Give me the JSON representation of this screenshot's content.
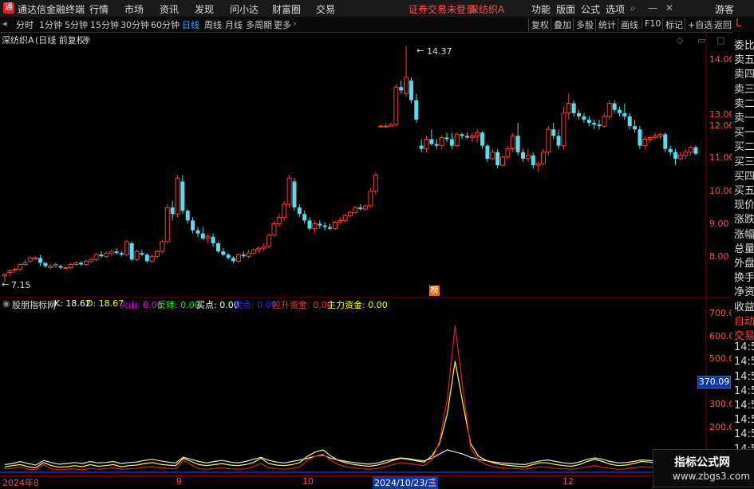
{
  "app": {
    "title": "通达信金融终端",
    "menu": [
      "行情",
      "市场",
      "资讯",
      "发现",
      "问小达",
      "财富圈",
      "交易"
    ],
    "warning": "证券交易未登录",
    "stock_title": "深纺织A",
    "right_menu": [
      "功能",
      "版面",
      "公式",
      "选项"
    ],
    "guest": "游客"
  },
  "toolbar": {
    "periods": [
      "分时",
      "1分钟",
      "5分钟",
      "15分钟",
      "30分钟",
      "60分钟",
      "日线",
      "周线",
      "月线",
      "多周期",
      "更多"
    ],
    "active_period": "日线",
    "right_buttons": [
      "复权",
      "叠加",
      "多股",
      "统计",
      "画线",
      "F10",
      "标记",
      "+自选",
      "返回"
    ]
  },
  "chart_header": {
    "name": "深纺织A",
    "mode": "(日线 前复权)"
  },
  "price_axis": [
    "14.00",
    "13.00",
    "12.00",
    "11.00",
    "10.00",
    "9.00",
    "8.00"
  ],
  "price_markers": {
    "high": "14.37",
    "low": "7.15"
  },
  "marker_label": "榜",
  "indicator": {
    "name": "股朋指标网",
    "items": [
      {
        "label": "K:",
        "value": "18.62",
        "color": "#ffffff"
      },
      {
        "label": "D:",
        "value": "18.67",
        "color": "#ffff00"
      },
      {
        "label": "火山:",
        "value": "0.00",
        "color": "#ff00ff"
      },
      {
        "label": "反转:",
        "value": "0.00",
        "color": "#00ff00"
      },
      {
        "label": "买点:",
        "value": "0.00",
        "color": "#ffffff"
      },
      {
        "label": "卖点:",
        "value": "0.00",
        "color": "#0000ff"
      },
      {
        "label": "拉升资金:",
        "value": "0.00",
        "color": "#ff3030"
      },
      {
        "label": "主力资金:",
        "value": "0.00",
        "color": "#ffff00"
      }
    ],
    "axis": [
      "700.0",
      "600.0",
      "500.0",
      "400.0",
      "300.0",
      "200.0"
    ],
    "current": "370.09"
  },
  "date_axis": {
    "labels": [
      "2024年8",
      "9",
      "10",
      "2024/10/23/三",
      "1",
      "12"
    ],
    "highlight": "2024/10/23/三"
  },
  "right_panel": [
    "委比",
    "卖五",
    "卖四",
    "卖三",
    "卖二",
    "卖一",
    "买一",
    "买二",
    "买三",
    "买四",
    "买五",
    "现价",
    "涨跌",
    "涨幅",
    "总量",
    "外盘",
    "换手",
    "净资",
    "收益",
    "自动",
    "交易",
    "14:56",
    "14:56",
    "14:56",
    "14:56",
    "14:56",
    "14:56",
    "14:56",
    "14:56",
    "14:56"
  ],
  "watermark": {
    "title": "指标公式网",
    "url": "www.zbgs3.com"
  },
  "chart_data": {
    "type": "candlestick",
    "ylim": [
      7.0,
      14.6
    ],
    "bars": [
      [
        7.3,
        7.4,
        7.1,
        7.35
      ],
      [
        7.4,
        7.5,
        7.3,
        7.45
      ],
      [
        7.5,
        7.55,
        7.4,
        7.5
      ],
      [
        7.5,
        7.7,
        7.45,
        7.65
      ],
      [
        7.65,
        7.8,
        7.6,
        7.7
      ],
      [
        7.75,
        7.9,
        7.7,
        7.85
      ],
      [
        7.85,
        7.9,
        7.8,
        7.85
      ],
      [
        7.85,
        7.95,
        7.6,
        7.7
      ],
      [
        7.7,
        7.7,
        7.55,
        7.6
      ],
      [
        7.55,
        7.65,
        7.5,
        7.6
      ],
      [
        7.6,
        7.7,
        7.55,
        7.65
      ],
      [
        7.6,
        7.65,
        7.5,
        7.55
      ],
      [
        7.55,
        7.6,
        7.5,
        7.55
      ],
      [
        7.55,
        7.7,
        7.5,
        7.65
      ],
      [
        7.65,
        7.75,
        7.6,
        7.7
      ],
      [
        7.7,
        7.75,
        7.6,
        7.65
      ],
      [
        7.65,
        7.8,
        7.6,
        7.75
      ],
      [
        7.75,
        7.85,
        7.7,
        7.8
      ],
      [
        7.8,
        8.0,
        7.75,
        7.95
      ],
      [
        7.95,
        8.05,
        7.85,
        7.9
      ],
      [
        7.9,
        8.05,
        7.85,
        8.0
      ],
      [
        8.0,
        8.1,
        7.9,
        8.05
      ],
      [
        8.05,
        8.15,
        7.95,
        8.0
      ],
      [
        8.0,
        8.05,
        7.9,
        7.95
      ],
      [
        7.95,
        8.4,
        7.9,
        8.35
      ],
      [
        8.3,
        8.35,
        7.75,
        7.8
      ],
      [
        7.8,
        8.1,
        7.75,
        8.05
      ],
      [
        8.0,
        8.1,
        7.9,
        7.95
      ],
      [
        7.95,
        8.0,
        7.7,
        7.75
      ],
      [
        7.75,
        7.95,
        7.7,
        7.9
      ],
      [
        7.9,
        8.1,
        7.85,
        8.05
      ],
      [
        8.05,
        8.4,
        8.0,
        8.35
      ],
      [
        8.35,
        9.5,
        8.3,
        9.4
      ],
      [
        9.4,
        9.6,
        9.0,
        9.2
      ],
      [
        9.2,
        10.4,
        9.1,
        10.3
      ],
      [
        10.2,
        10.4,
        9.2,
        9.3
      ],
      [
        9.3,
        9.35,
        8.9,
        9.0
      ],
      [
        9.0,
        9.1,
        8.6,
        8.7
      ],
      [
        8.7,
        8.8,
        8.5,
        8.6
      ],
      [
        8.6,
        8.8,
        8.4,
        8.45
      ],
      [
        8.45,
        8.6,
        8.3,
        8.5
      ],
      [
        8.5,
        8.6,
        8.2,
        8.3
      ],
      [
        8.3,
        8.35,
        8.0,
        8.05
      ],
      [
        8.05,
        8.15,
        7.9,
        7.95
      ],
      [
        7.95,
        8.0,
        7.8,
        7.85
      ],
      [
        7.85,
        7.9,
        7.7,
        7.75
      ],
      [
        7.75,
        8.0,
        7.7,
        7.95
      ],
      [
        7.95,
        8.05,
        7.85,
        7.9
      ],
      [
        7.9,
        8.1,
        7.85,
        8.0
      ],
      [
        8.0,
        8.15,
        7.95,
        8.1
      ],
      [
        8.1,
        8.2,
        8.0,
        8.15
      ],
      [
        8.15,
        8.3,
        8.05,
        8.2
      ],
      [
        8.2,
        8.6,
        8.15,
        8.55
      ],
      [
        8.55,
        9.0,
        8.5,
        8.9
      ],
      [
        8.9,
        9.2,
        8.8,
        9.1
      ],
      [
        9.1,
        9.6,
        9.0,
        9.5
      ],
      [
        9.5,
        10.4,
        9.4,
        10.3
      ],
      [
        10.2,
        10.3,
        9.3,
        9.4
      ],
      [
        9.4,
        9.5,
        9.1,
        9.2
      ],
      [
        9.2,
        9.3,
        8.9,
        9.0
      ],
      [
        9.0,
        9.1,
        8.7,
        8.75
      ],
      [
        8.75,
        9.0,
        8.6,
        8.9
      ],
      [
        8.9,
        9.0,
        8.75,
        8.85
      ],
      [
        8.85,
        8.95,
        8.7,
        8.8
      ],
      [
        8.8,
        8.9,
        8.7,
        8.75
      ],
      [
        8.75,
        9.0,
        8.7,
        8.95
      ],
      [
        8.95,
        9.1,
        8.9,
        9.0
      ],
      [
        9.0,
        9.2,
        8.95,
        9.15
      ],
      [
        9.15,
        9.3,
        9.1,
        9.25
      ],
      [
        9.25,
        9.45,
        9.2,
        9.4
      ],
      [
        9.4,
        9.5,
        9.3,
        9.35
      ],
      [
        9.35,
        9.5,
        9.3,
        9.45
      ],
      [
        9.45,
        10.0,
        9.4,
        9.9
      ],
      [
        9.9,
        10.5,
        9.8,
        10.4
      ],
      [
        11.9,
        11.95,
        11.9,
        11.9
      ],
      [
        11.9,
        12.0,
        11.85,
        11.9
      ],
      [
        11.9,
        12.0,
        11.9,
        11.95
      ],
      [
        11.95,
        13.2,
        11.9,
        13.1
      ],
      [
        13.1,
        13.3,
        12.9,
        13.0
      ],
      [
        12.9,
        14.37,
        12.8,
        13.4
      ],
      [
        13.3,
        13.4,
        12.6,
        12.7
      ],
      [
        12.7,
        12.9,
        12.0,
        12.1
      ],
      [
        11.3,
        11.5,
        11.1,
        11.2
      ],
      [
        11.2,
        11.6,
        11.1,
        11.5
      ],
      [
        11.5,
        11.8,
        11.3,
        11.35
      ],
      [
        11.35,
        11.5,
        11.2,
        11.3
      ],
      [
        11.3,
        11.6,
        11.2,
        11.55
      ],
      [
        11.55,
        11.7,
        11.4,
        11.5
      ],
      [
        11.5,
        11.7,
        11.2,
        11.3
      ],
      [
        11.3,
        11.7,
        11.25,
        11.65
      ],
      [
        11.65,
        11.7,
        11.5,
        11.6
      ],
      [
        11.6,
        11.7,
        11.5,
        11.55
      ],
      [
        11.55,
        11.7,
        11.4,
        11.6
      ],
      [
        11.6,
        11.8,
        11.4,
        11.7
      ],
      [
        11.7,
        11.75,
        11.2,
        11.3
      ],
      [
        11.3,
        11.35,
        10.8,
        10.9
      ],
      [
        10.9,
        11.2,
        10.85,
        11.1
      ],
      [
        11.1,
        11.2,
        10.6,
        10.7
      ],
      [
        10.7,
        11.0,
        10.65,
        10.95
      ],
      [
        10.95,
        11.3,
        10.9,
        11.2
      ],
      [
        11.2,
        11.7,
        11.1,
        11.6
      ],
      [
        11.6,
        12.0,
        11.0,
        11.1
      ],
      [
        11.1,
        11.2,
        10.8,
        10.9
      ],
      [
        10.9,
        11.2,
        10.8,
        11.0
      ],
      [
        11.0,
        11.1,
        10.6,
        10.7
      ],
      [
        10.7,
        10.8,
        10.5,
        10.75
      ],
      [
        10.75,
        11.2,
        10.7,
        11.1
      ],
      [
        11.1,
        11.9,
        11.0,
        11.8
      ],
      [
        11.8,
        12.0,
        11.5,
        11.6
      ],
      [
        11.6,
        11.8,
        11.2,
        11.3
      ],
      [
        11.3,
        12.5,
        11.2,
        12.3
      ],
      [
        12.3,
        12.9,
        12.1,
        12.6
      ],
      [
        12.6,
        12.7,
        12.2,
        12.3
      ],
      [
        12.3,
        12.4,
        12.1,
        12.2
      ],
      [
        12.2,
        12.3,
        12.0,
        12.1
      ],
      [
        12.1,
        12.2,
        11.9,
        12.0
      ],
      [
        12.0,
        12.1,
        11.8,
        11.95
      ],
      [
        11.95,
        12.1,
        11.8,
        11.9
      ],
      [
        11.9,
        12.3,
        11.85,
        12.2
      ],
      [
        12.2,
        12.7,
        12.1,
        12.6
      ],
      [
        12.6,
        12.7,
        12.3,
        12.4
      ],
      [
        12.4,
        12.5,
        12.2,
        12.3
      ],
      [
        12.3,
        12.6,
        12.1,
        12.2
      ],
      [
        12.2,
        12.3,
        11.8,
        11.9
      ],
      [
        11.9,
        12.1,
        11.7,
        11.8
      ],
      [
        11.8,
        11.9,
        11.2,
        11.3
      ],
      [
        11.3,
        11.6,
        11.2,
        11.5
      ],
      [
        11.5,
        11.6,
        11.4,
        11.55
      ],
      [
        11.55,
        11.7,
        11.5,
        11.6
      ],
      [
        11.6,
        11.7,
        11.5,
        11.65
      ],
      [
        11.65,
        11.7,
        11.1,
        11.2
      ],
      [
        11.2,
        11.3,
        11.0,
        11.1
      ],
      [
        11.1,
        11.2,
        10.7,
        10.9
      ],
      [
        10.9,
        11.1,
        10.85,
        11.0
      ],
      [
        11.0,
        11.2,
        10.9,
        11.1
      ],
      [
        11.1,
        11.3,
        11.0,
        11.25
      ],
      [
        11.25,
        11.3,
        11.0,
        11.05
      ]
    ],
    "indicator_series": {
      "ylim": [
        0,
        760
      ],
      "red": [
        20,
        22,
        30,
        18,
        15,
        40,
        20,
        15,
        18,
        20,
        15,
        22,
        18,
        20,
        25,
        18,
        20,
        22,
        28,
        30,
        25,
        22,
        20,
        60,
        40,
        20,
        18,
        22,
        25,
        20,
        18,
        20,
        30,
        45,
        25,
        20,
        18,
        22,
        30,
        60,
        80,
        90,
        60,
        40,
        30,
        25,
        20,
        18,
        22,
        30,
        40,
        50,
        45,
        40,
        35,
        60,
        150,
        350,
        700,
        400,
        120,
        60,
        40,
        30,
        25,
        22,
        20,
        18,
        25,
        30,
        28,
        22,
        20,
        18,
        22,
        30,
        35,
        28,
        22,
        18,
        20,
        25,
        30,
        28,
        25,
        22,
        20,
        18,
        20,
        22
      ],
      "yellow": [
        30,
        35,
        40,
        30,
        25,
        50,
        35,
        28,
        30,
        35,
        30,
        40,
        32,
        35,
        40,
        30,
        35,
        38,
        45,
        50,
        42,
        38,
        35,
        70,
        55,
        40,
        35,
        40,
        45,
        38,
        35,
        40,
        50,
        70,
        45,
        38,
        35,
        40,
        50,
        80,
        100,
        110,
        80,
        60,
        48,
        40,
        35,
        32,
        38,
        48,
        60,
        70,
        65,
        58,
        52,
        80,
        140,
        280,
        530,
        330,
        140,
        80,
        60,
        48,
        40,
        36,
        32,
        30,
        40,
        50,
        48,
        40,
        35,
        32,
        40,
        55,
        65,
        55,
        42,
        35,
        38,
        45,
        55,
        52,
        45,
        40,
        36,
        32,
        35,
        38
      ],
      "white": [
        40,
        45,
        55,
        45,
        38,
        60,
        50,
        42,
        45,
        50,
        45,
        55,
        48,
        50,
        55,
        45,
        50,
        52,
        60,
        65,
        58,
        52,
        48,
        75,
        65,
        55,
        48,
        55,
        60,
        52,
        48,
        55,
        65,
        75,
        60,
        52,
        48,
        55,
        62,
        70,
        80,
        85,
        70,
        62,
        55,
        50,
        45,
        42,
        48,
        58,
        65,
        72,
        68,
        62,
        58,
        70,
        90,
        110,
        100,
        90,
        75,
        65,
        58,
        52,
        48,
        45,
        42,
        40,
        50,
        58,
        62,
        55,
        48,
        45,
        52,
        65,
        72,
        65,
        55,
        48,
        50,
        55,
        62,
        60,
        55,
        50,
        46,
        42,
        45,
        48
      ]
    }
  }
}
